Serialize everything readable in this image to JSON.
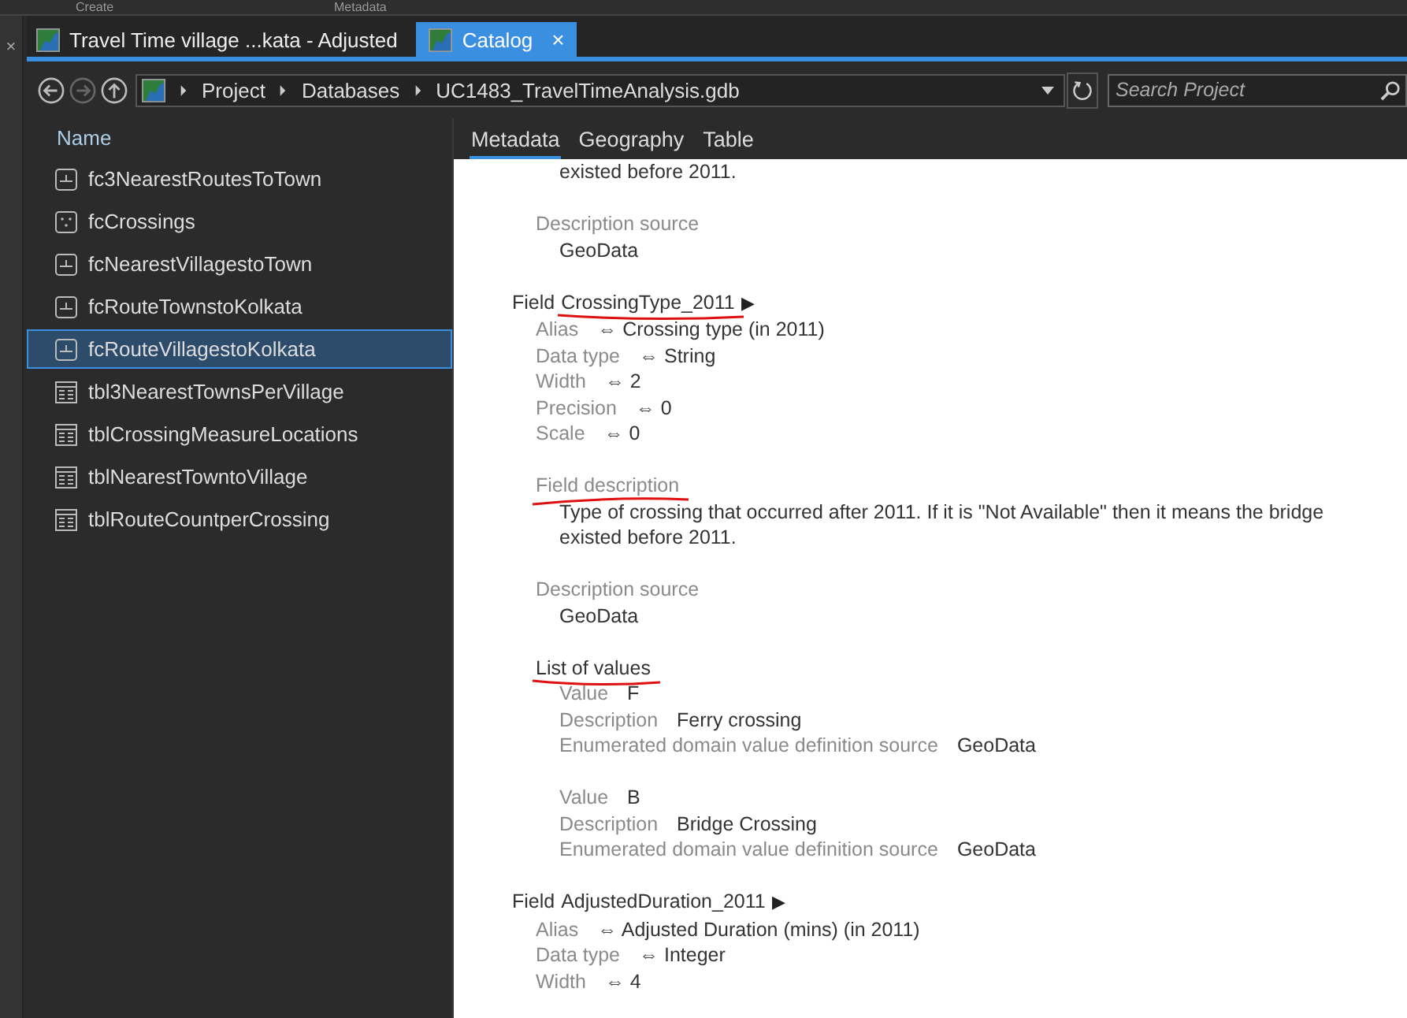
{
  "ribbon": {
    "groups": [
      "Create",
      "Metadata"
    ]
  },
  "side_close": "×",
  "tabs": [
    {
      "label": "Travel Time village ...kata - Adjusted",
      "selected": false
    },
    {
      "label": "Catalog",
      "selected": true,
      "close": "×"
    }
  ],
  "navigation": {
    "breadcrumbs": [
      "Project",
      "Databases",
      "UC1483_TravelTimeAnalysis.gdb"
    ],
    "search": {
      "placeholder": "Search Project"
    }
  },
  "contents": {
    "column": "Name",
    "items": [
      {
        "name": "fc3NearestRoutesToTown",
        "kind": "line",
        "selected": false
      },
      {
        "name": "fcCrossings",
        "kind": "point",
        "selected": false
      },
      {
        "name": "fcNearestVillagestoTown",
        "kind": "line",
        "selected": false
      },
      {
        "name": "fcRouteTownstoKolkata",
        "kind": "line",
        "selected": false
      },
      {
        "name": "fcRouteVillagestoKolkata",
        "kind": "line",
        "selected": true
      },
      {
        "name": "tbl3NearestTownsPerVillage",
        "kind": "table",
        "selected": false
      },
      {
        "name": "tblCrossingMeasureLocations",
        "kind": "table",
        "selected": false
      },
      {
        "name": "tblNearestTowntoVillage",
        "kind": "table",
        "selected": false
      },
      {
        "name": "tblRouteCountperCrossing",
        "kind": "table",
        "selected": false
      }
    ]
  },
  "view_tabs": [
    {
      "label": "Metadata",
      "selected": true
    },
    {
      "label": "Geography",
      "selected": false
    },
    {
      "label": "Table",
      "selected": false
    }
  ],
  "metadata": {
    "continuation": "existed before 2011.",
    "sections": [
      {
        "title": "Description source",
        "body": "GeoData"
      }
    ],
    "fields": [
      {
        "label": "Field",
        "name": "CrossingType_2011",
        "arrow": "▶",
        "marked": true,
        "properties": [
          {
            "label": "Alias",
            "link": "⇔",
            "value": "Crossing type (in 2011)"
          },
          {
            "label": "Data type",
            "link": "⇔",
            "value": "String"
          },
          {
            "label": "Width",
            "link": "⇔",
            "value": "2"
          },
          {
            "label": "Precision",
            "link": "⇔",
            "value": "0"
          },
          {
            "label": "Scale",
            "link": "⇔",
            "value": "0"
          }
        ],
        "sections": [
          {
            "title": "Field description",
            "marked": true,
            "body": "Type of crossing that occurred after 2011. If it is \"Not Available\" then it means the bridge existed before 2011."
          },
          {
            "title": "Description source",
            "body": "GeoData"
          }
        ],
        "value_list": {
          "title": "List of values",
          "marked": true,
          "entries": [
            [
              {
                "label": "Value",
                "value": "F"
              },
              {
                "label": "Description",
                "value": "Ferry crossing"
              },
              {
                "label": "Enumerated domain value definition source",
                "value": "GeoData"
              }
            ],
            [
              {
                "label": "Value",
                "value": "B"
              },
              {
                "label": "Description",
                "value": "Bridge Crossing"
              },
              {
                "label": "Enumerated domain value definition source",
                "value": "GeoData"
              }
            ]
          ]
        }
      },
      {
        "label": "Field",
        "name": "AdjustedDuration_2011",
        "arrow": "▶",
        "properties": [
          {
            "label": "Alias",
            "link": "⇔",
            "value": "Adjusted Duration (mins) (in 2011)"
          },
          {
            "label": "Data type",
            "link": "⇔",
            "value": "Integer"
          },
          {
            "label": "Width",
            "link": "⇔",
            "value": "4"
          }
        ]
      }
    ]
  }
}
